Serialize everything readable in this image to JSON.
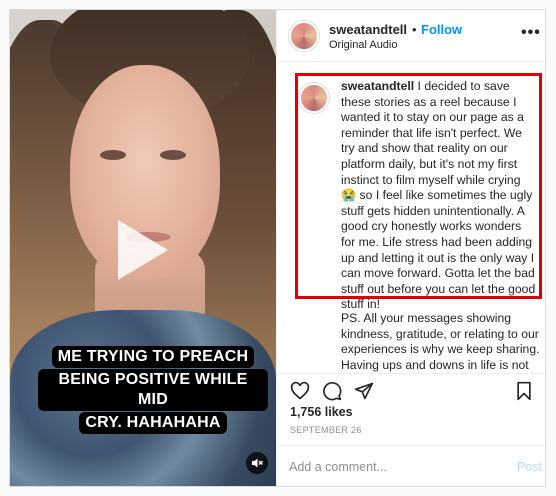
{
  "post": {
    "username": "sweatandtell",
    "separator": "•",
    "follow_label": "Follow",
    "audio_label": "Original Audio",
    "more_icon": "more-options-icon"
  },
  "video": {
    "caption_lines": [
      "ME TRYING TO PREACH",
      "BEING POSITIVE WHILE MID",
      "CRY. HAHAHAHA"
    ],
    "play_icon": "play-icon",
    "mute_icon": "muted-speaker-icon"
  },
  "caption_comment": {
    "username": "sweatandtell",
    "text": " I decided to save these stories as a reel because I wanted it to stay on our page as a reminder that life isn't perfect. We try and show that reality on our platform daily, but it's not my first instinct to film myself while crying 😭 so I feel like sometimes the ugly stuff gets hidden unintentionally. A good cry honestly works wonders for me. Life stress had been adding up and letting it out is the only way I can move forward. Gotta let the bad stuff out before you can let the good stuff in!",
    "ps_text": "PS. All your messages showing kindness, gratitude, or relating to our experiences is why we keep sharing. Having ups and downs in life is not"
  },
  "actions": {
    "icons": [
      "heart-icon",
      "comment-icon",
      "share-icon",
      "save-bookmark-icon"
    ]
  },
  "stats": {
    "likes": "1,756 likes",
    "date": "SEPTEMBER 26"
  },
  "add_comment": {
    "placeholder": "Add a comment...",
    "post_label": "Post"
  },
  "colors": {
    "follow": "#0095f6",
    "highlight_border": "#e00000",
    "post_disabled": "#b3dbff"
  }
}
